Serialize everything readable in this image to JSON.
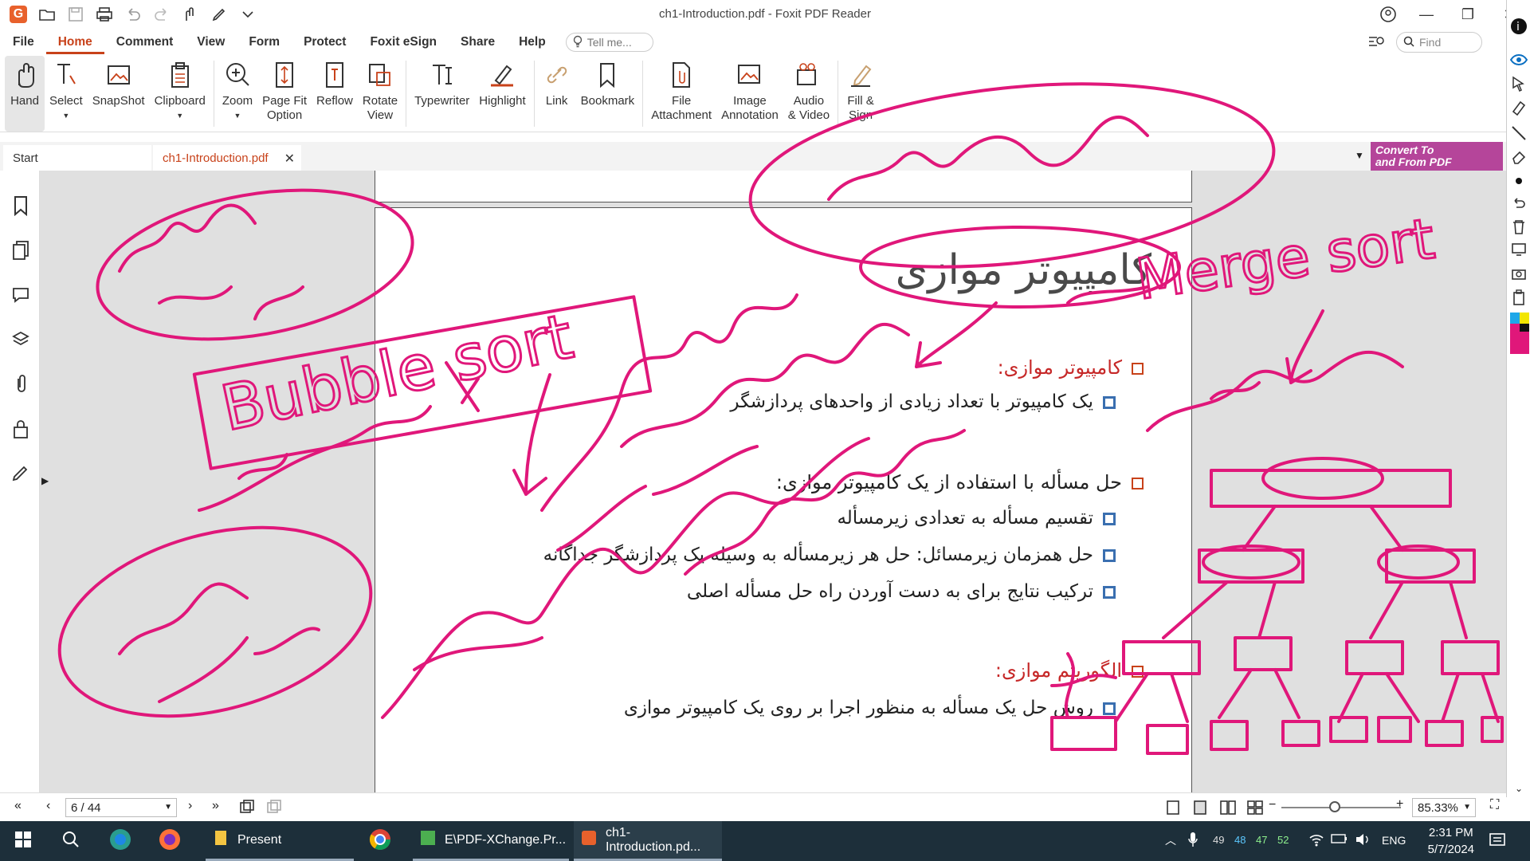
{
  "window": {
    "title": "ch1-Introduction.pdf - Foxit PDF Reader"
  },
  "menu": [
    "File",
    "Home",
    "Comment",
    "View",
    "Form",
    "Protect",
    "Foxit eSign",
    "Share",
    "Help"
  ],
  "menu_active": "Home",
  "tellme_placeholder": "Tell me...",
  "find_placeholder": "Find",
  "ribbon": {
    "hand": "Hand",
    "select": "Select",
    "snapshot": "SnapShot",
    "clipboard": "Clipboard",
    "zoom": "Zoom",
    "pagefit_1": "Page Fit",
    "pagefit_2": "Option",
    "reflow": "Reflow",
    "rotate_1": "Rotate",
    "rotate_2": "View",
    "typewriter": "Typewriter",
    "highlight": "Highlight",
    "link": "Link",
    "bookmark": "Bookmark",
    "fileatt_1": "File",
    "fileatt_2": "Attachment",
    "imageann_1": "Image",
    "imageann_2": "Annotation",
    "audio_1": "Audio",
    "audio_2": "& Video",
    "fill_1": "Fill &",
    "fill_2": "Sign"
  },
  "tabs": {
    "start": "Start",
    "doc": "ch1-Introduction.pdf"
  },
  "convert": {
    "line1": "Convert To",
    "line2": "and From PDF"
  },
  "slide": {
    "title": "کامپیوتر موازی",
    "h1": "کامپیوتر موازی:",
    "b1": "یک کامپیوتر با تعداد زیادی از واحدهای پردازشگر",
    "h2": "حل مسأله با استفاده از یک کامپیوتر موازی:",
    "b2": "تقسیم مسأله به تعدادی زیرمسأله",
    "b3": "حل همزمان زیرمسائل: حل هر زیرمسأله به وسیله یک پردازشگر جداگانه",
    "b4": "ترکیب نتایج برای به دست آوردن راه حل مسأله اصلی",
    "h3": "الگوریتم موازی:",
    "b5": "روش حل یک مسأله به منظور اجرا بر روی یک کامپیوتر موازی"
  },
  "ink_text": {
    "bubble": "Bubble sort",
    "merge": "Merge sort"
  },
  "status": {
    "page": "6 / 44",
    "zoom": "85.33%"
  },
  "taskbar": {
    "present": "Present",
    "pdfx": "E\\PDF-XChange.Pr...",
    "foxit": "ch1-Introduction.pd...",
    "n1": "49",
    "n2": "48",
    "n3": "47",
    "n4": "52",
    "lang": "ENG",
    "time": "2:31 PM",
    "date": "5/7/2024"
  },
  "colors": {
    "accent": "#c8421a",
    "ink": "#e0177a",
    "taskbar": "#1d2f3a",
    "convert": "#b5459a"
  }
}
